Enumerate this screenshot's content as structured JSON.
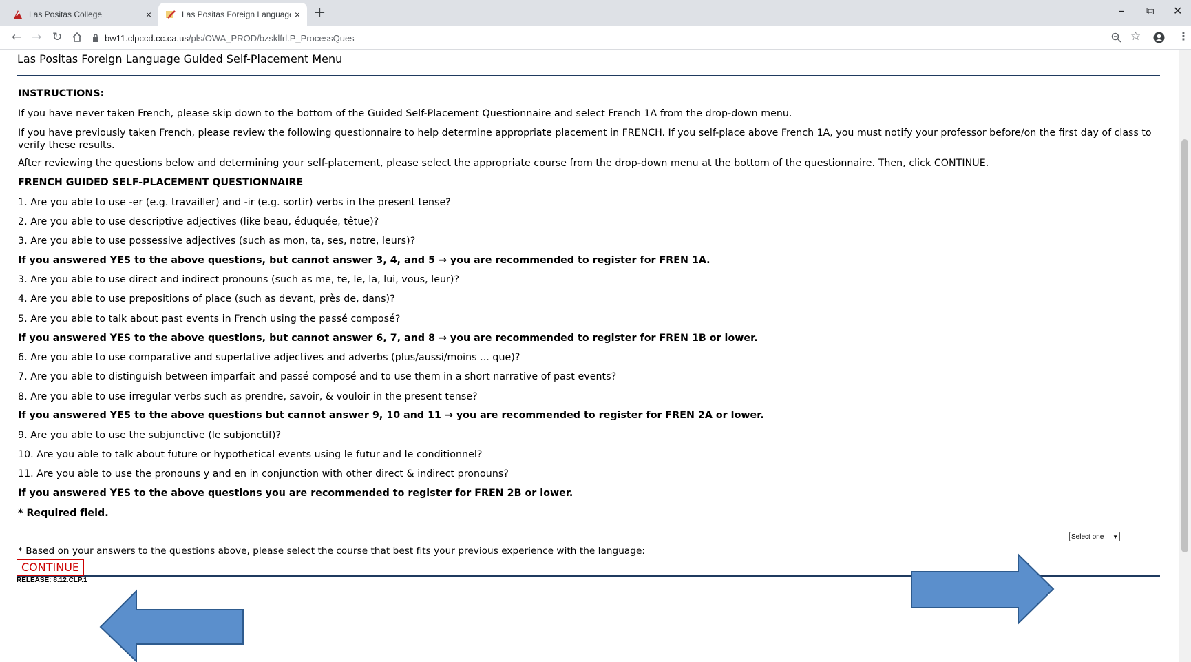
{
  "browser": {
    "tabs": [
      {
        "title": "Las Positas College",
        "active": false
      },
      {
        "title": "Las Positas Foreign Language Gu",
        "active": true
      }
    ],
    "new_tab_symbol": "+",
    "close_symbol": "×",
    "url_host": "bw11.clpccd.cc.ca.us",
    "url_path": "/pls/OWA_PROD/bzsklfrl.P_ProcessQues",
    "window_controls": {
      "minimize": "–",
      "restore": "⧉",
      "close": "✕"
    },
    "icons": {
      "back": "arrow-left-icon",
      "forward": "arrow-right-icon",
      "reload": "reload-icon",
      "home": "home-icon",
      "lock": "lock-icon",
      "zoom": "zoom-icon",
      "star": "star-icon",
      "profile": "profile-icon",
      "menu": "kebab-menu-icon"
    }
  },
  "page": {
    "title": "Las Positas Foreign Language Guided Self-Placement Menu",
    "instructions_heading": "INSTRUCTIONS:",
    "instr1": "If you have never taken French, please skip down to the bottom of the Guided Self-Placement Questionnaire and select French 1A from the drop-down menu.",
    "instr2": "If you have previously taken French, please review the following questionnaire to help determine appropriate placement in FRENCH. If you self-place above French 1A, you must notify your professor before/on the first day of class to verify these results.",
    "instr3": "After reviewing the questions below and determining your self-placement, please select the appropriate course from the drop-down menu at the bottom of the questionnaire. Then, click CONTINUE.",
    "questionnaire_heading": "FRENCH GUIDED SELF-PLACEMENT QUESTIONNAIRE",
    "q1": "1. Are you able to use -er (e.g. travailler) and -ir (e.g. sortir) verbs in the present tense?",
    "q2": "2. Are you able to use descriptive adjectives (like beau, éduquée, têtue)?",
    "q3a": "3. Are you able to use possessive adjectives (such as mon, ta, ses, notre, leurs)?",
    "rec1": "If you answered YES to the above questions, but cannot answer 3, 4, and 5 → you are recommended to register for FREN 1A.",
    "q3b": "3. Are you able to use direct and indirect pronouns (such as me, te, le, la, lui, vous, leur)?",
    "q4": "4. Are you able to use prepositions of place (such as devant, près de, dans)?",
    "q5": "5. Are you able to talk about past events in French using the passé composé?",
    "rec2": "If you answered YES to the above questions, but cannot answer 6, 7, and 8 → you are recommended to register for FREN 1B or lower.",
    "q6": "6. Are you able to use comparative and superlative adjectives and adverbs (plus/aussi/moins ... que)?",
    "q7": "7. Are you able to distinguish between imparfait and passé composé and to use them in a short narrative of past events?",
    "q8": "8. Are you able to use irregular verbs such as prendre, savoir, & vouloir in the present tense?",
    "rec3": "If you answered YES to the above questions but cannot answer 9, 10 and 11 → you are recommended to register for FREN 2A or lower.",
    "q9": "9. Are you able to use the subjunctive (le subjonctif)?",
    "q10": "10. Are you able to talk about future or hypothetical events using le futur and le conditionnel?",
    "q11": "11. Are you able to use the pronouns y and en in conjunction with other direct & indirect pronouns?",
    "rec4": "If you answered YES to the above questions you are recommended to register for FREN 2B or lower.",
    "required_note": "* Required field.",
    "select_prompt": "* Based on your answers to the questions above, please select the course that best fits your previous experience with the language:",
    "select_value": "Select one",
    "continue_label": "CONTINUE",
    "release": "RELEASE: 8.12.CLP.1"
  },
  "colors": {
    "arrow_fill": "#5b8fcc",
    "arrow_stroke": "#2e5b8e",
    "rule": "#1f3a5f",
    "continue": "#cc0000"
  }
}
